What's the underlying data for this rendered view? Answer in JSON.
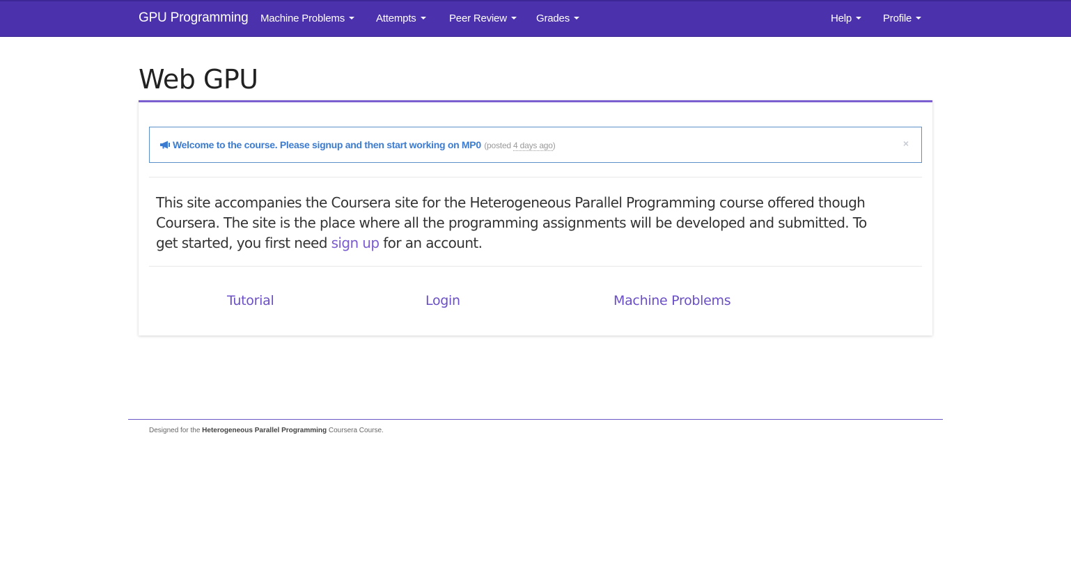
{
  "navbar": {
    "brand": "GPU Programming",
    "left_items": [
      {
        "label": "Machine Problems"
      },
      {
        "label": "Attempts"
      },
      {
        "label": "Peer Review"
      },
      {
        "label": "Grades"
      }
    ],
    "right_items": [
      {
        "label": "Help"
      },
      {
        "label": "Profile"
      }
    ],
    "colors": {
      "background": "#4b32ac",
      "text": "#ffffff"
    }
  },
  "page": {
    "title": "Web GPU"
  },
  "announcement": {
    "icon": "megaphone-icon",
    "message": "Welcome to the course. Please signup and then start working on MP0",
    "posted_prefix": "(posted ",
    "posted_ago": "4 days ago",
    "posted_suffix": ")",
    "close_label": "×"
  },
  "intro": {
    "text_before": "This site accompanies the Coursera site for the Heterogeneous Parallel Programming course offered though Coursera. The site is the place where all the programming assignments will be developed and submitted. To get started, you first need ",
    "signup_link": "sign up",
    "text_after": " for an account."
  },
  "quick_links": [
    {
      "label": "Tutorial"
    },
    {
      "label": "Login"
    },
    {
      "label": "Machine Problems"
    }
  ],
  "footer": {
    "prefix": "Designed for the ",
    "course": "Heterogeneous Parallel Programming",
    "suffix": " Coursera Course."
  },
  "accent_color": "#7b5fd0"
}
